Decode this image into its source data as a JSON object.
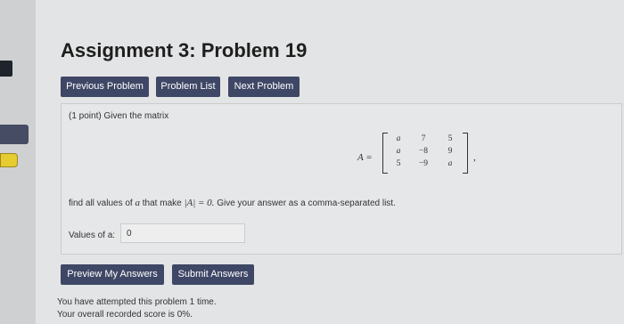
{
  "title": "Assignment 3: Problem 19",
  "nav": {
    "previous": "Previous Problem",
    "list": "Problem List",
    "next": "Next Problem"
  },
  "problem": {
    "points": "(1 point) Given the matrix",
    "matrix_label": "A =",
    "matrix": [
      [
        "a",
        "7",
        "5"
      ],
      [
        "a",
        "−8",
        "9"
      ],
      [
        "5",
        "−9",
        "a"
      ]
    ],
    "matrix_suffix": ",",
    "find_prefix": "find all values of",
    "find_var": "a",
    "find_mid": "that make",
    "find_det": "|A| = 0.",
    "find_suffix": "Give your answer as a comma-separated list."
  },
  "answer": {
    "label": "Values of a:",
    "value": "0"
  },
  "actions": {
    "preview": "Preview My Answers",
    "submit": "Submit Answers"
  },
  "status": {
    "attempts": "You have attempted this problem 1 time.",
    "score": "Your overall recorded score is 0%."
  },
  "colors": {
    "button_bg": "#3f4766",
    "badge": "#e6cc2e"
  }
}
